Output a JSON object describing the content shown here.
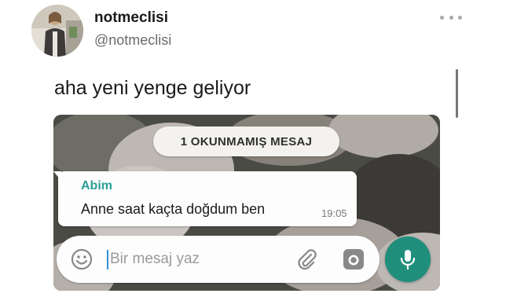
{
  "tweet": {
    "display_name": "notmeclisi",
    "handle": "@notmeclisi",
    "text": "aha yeni yenge geliyor"
  },
  "whatsapp": {
    "unread_banner": "1 OKUNMAMIŞ MESAJ",
    "message": {
      "sender": "Abim",
      "text": "Anne saat kaçta doğdum ben",
      "time": "19:05"
    },
    "input": {
      "placeholder": "Bir mesaj yaz"
    },
    "colors": {
      "sender": "#2aa196",
      "mic_button": "#1f8f7c"
    },
    "icons": [
      "emoji-icon",
      "paperclip-icon",
      "camera-icon",
      "microphone-icon"
    ]
  }
}
